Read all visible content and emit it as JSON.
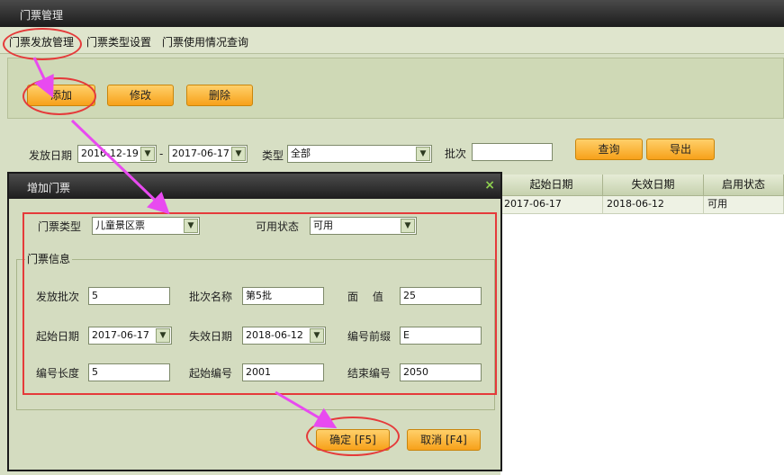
{
  "window": {
    "title": "门票管理"
  },
  "tabs": [
    {
      "label": "门票发放管理"
    },
    {
      "label": "门票类型设置"
    },
    {
      "label": "门票使用情况查询"
    }
  ],
  "toolbar": {
    "add": "添加",
    "edit": "修改",
    "delete": "删除"
  },
  "filter": {
    "issue_date_label": "发放日期",
    "date_from": "2016-12-19",
    "dash": "-",
    "date_to": "2017-06-17",
    "type_label": "类型",
    "type_value": "全部",
    "batch_label": "批次",
    "batch_value": "",
    "query": "查询",
    "export": "导出"
  },
  "grid": {
    "columns": [
      "起始日期",
      "失效日期",
      "启用状态"
    ],
    "rows": [
      [
        "2017-06-17",
        "2018-06-12",
        "可用"
      ]
    ]
  },
  "dialog": {
    "title": "增加门票",
    "close": "×",
    "ticket_type_label": "门票类型",
    "ticket_type_value": "儿童景区票",
    "status_label": "可用状态",
    "status_value": "可用",
    "group_title": "门票信息",
    "fields": {
      "batch_no_label": "发放批次",
      "batch_no": "5",
      "batch_name_label": "批次名称",
      "batch_name": "第5批",
      "face_value_label": "面　 值",
      "face_value": "25",
      "start_date_label": "起始日期",
      "start_date": "2017-06-17",
      "expire_date_label": "失效日期",
      "expire_date": "2018-06-12",
      "prefix_label": "编号前缀",
      "prefix": "E",
      "code_len_label": "编号长度",
      "code_len": "5",
      "start_no_label": "起始编号",
      "start_no": "2001",
      "end_no_label": "结束编号",
      "end_no": "2050"
    },
    "ok": "确定 [F5]",
    "cancel": "取消 [F4]"
  },
  "colors": {
    "annotation": "#e53a3a",
    "arrow": "#e84af0",
    "button": "#f7a11a"
  }
}
